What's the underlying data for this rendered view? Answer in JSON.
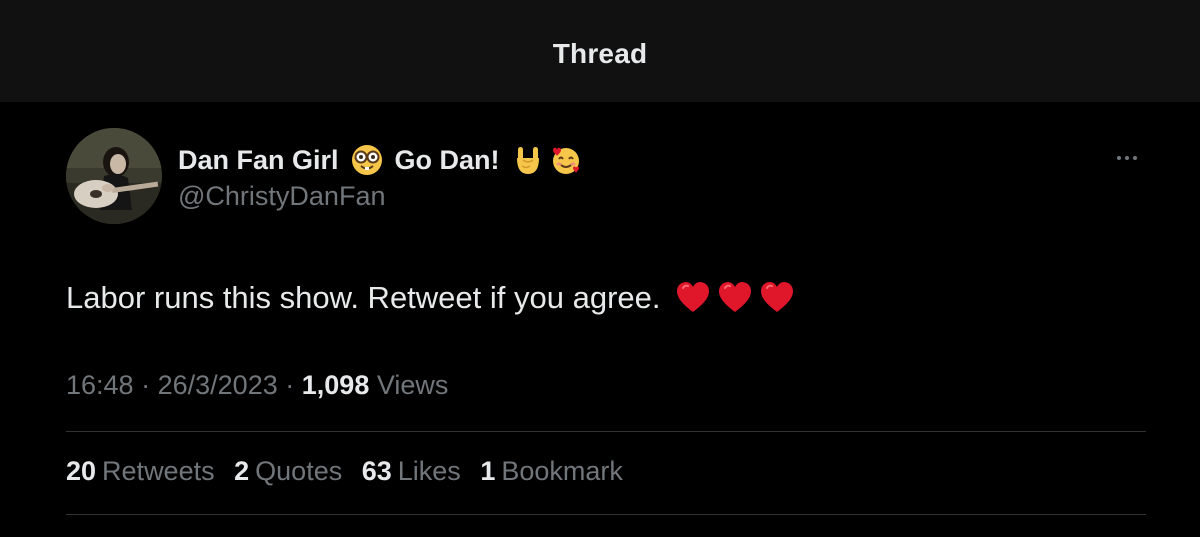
{
  "header": {
    "title": "Thread"
  },
  "tweet": {
    "author": {
      "name_part1": "Dan Fan Girl",
      "name_part2": "Go Dan!",
      "handle": "@ChristyDanFan"
    },
    "text": "Labor runs this show. Retweet if you agree.",
    "time": "16:48",
    "separator": "·",
    "date": "26/3/2023",
    "views_count": "1,098",
    "views_label": "Views"
  },
  "stats": {
    "retweets_count": "20",
    "retweets_label": "Retweets",
    "quotes_count": "2",
    "quotes_label": "Quotes",
    "likes_count": "63",
    "likes_label": "Likes",
    "bookmarks_count": "1",
    "bookmarks_label": "Bookmark"
  },
  "icons": {
    "avatar": "avatar-photo-guitar",
    "emoji_1": "nerd-face-emoji-icon",
    "emoji_2": "sign-of-the-horns-emoji-icon",
    "emoji_3": "smiling-face-with-hearts-emoji-icon",
    "hearts": "red-heart-emoji-icon",
    "more": "more-options-icon"
  },
  "colors": {
    "background": "#000000",
    "header_background": "#111111",
    "primary_text": "#e7e9ea",
    "secondary_text": "#71767b",
    "divider": "#2f3336",
    "heart_red": "#e0162b"
  }
}
